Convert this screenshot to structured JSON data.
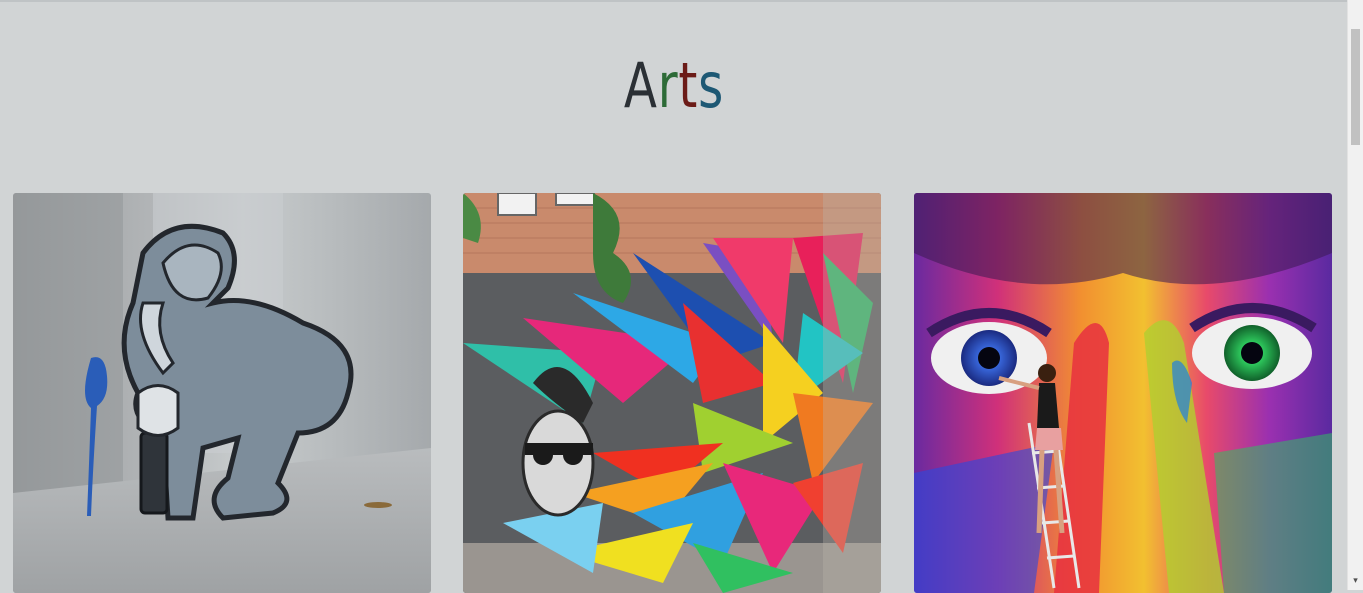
{
  "page": {
    "title_letters": [
      {
        "char": "A",
        "color": "#2b3035"
      },
      {
        "char": "r",
        "color": "#2d6b37"
      },
      {
        "char": "t",
        "color": "#6b1b17"
      },
      {
        "char": "s",
        "color": "#1d5874"
      }
    ]
  },
  "gallery": {
    "cards": [
      {
        "name": "boy-with-spray-can-art"
      },
      {
        "name": "colorful-star-mural"
      },
      {
        "name": "painted-face-mural"
      }
    ]
  },
  "scrollbar": {
    "down_arrow": "▾"
  }
}
